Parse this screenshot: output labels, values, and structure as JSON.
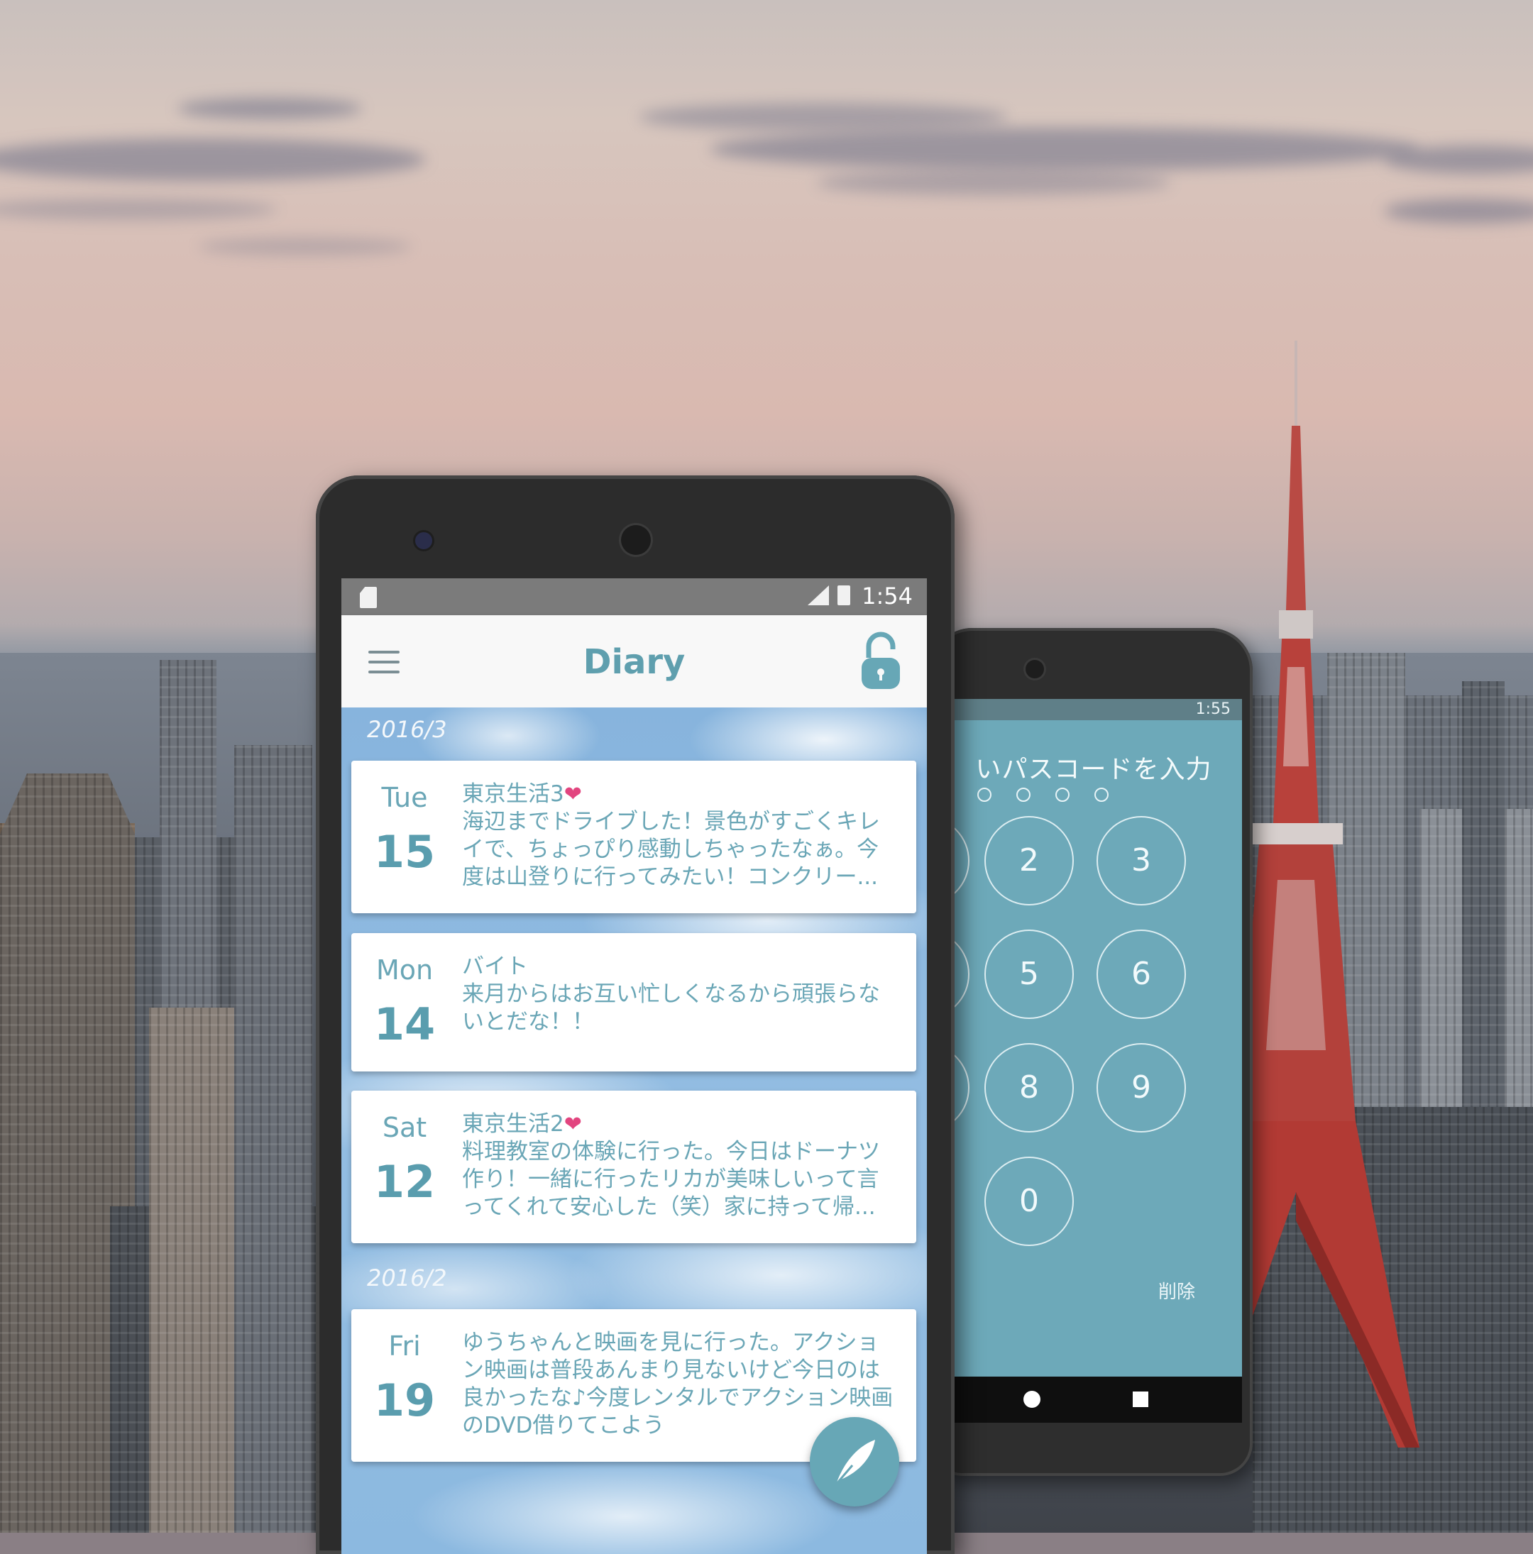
{
  "front_phone": {
    "status_bar": {
      "time": "1:54",
      "network": "4G"
    },
    "app_bar": {
      "title": "Diary",
      "menu_icon": "menu-icon",
      "lock_icon": "unlock-icon"
    },
    "months": [
      {
        "label": "2016/3"
      },
      {
        "label": "2016/2"
      }
    ],
    "entries": [
      {
        "dow": "Tue",
        "day": "15",
        "title": "東京生活3",
        "heart": "❤",
        "body": "海辺までドライブした！景色がすごくキレイで、ちょっぴり感動しちゃったなぁ。今度は山登りに行ってみたい！コンクリー..."
      },
      {
        "dow": "Mon",
        "day": "14",
        "title": "バイト",
        "heart": "",
        "body": "来月からはお互い忙しくなるから頑張らないとだな！！"
      },
      {
        "dow": "Sat",
        "day": "12",
        "title": "東京生活2",
        "heart": "❤",
        "body": "料理教室の体験に行った。今日はドーナツ作り！一緒に行ったリカが美味しいって言ってくれて安心した（笑）家に持って帰..."
      },
      {
        "dow": "Fri",
        "day": "19",
        "title": "",
        "heart": "",
        "body": "ゆうちゃんと映画を見に行った。アクション映画は普段あんまり見ないけど今日のは良かったな♪今度レンタルでアクション映画のDVD借りてこよう"
      }
    ],
    "fab_icon": "feather-pen-icon",
    "accent_color": "#67a7b6"
  },
  "back_phone": {
    "status_bar": {
      "time": "1:55",
      "network": "4G"
    },
    "passcode_title": "いパスコードを入力",
    "dots": 4,
    "keys": [
      "2",
      "3",
      "5",
      "6",
      "8",
      "9",
      "0"
    ],
    "delete_label": "削除",
    "screen_color": "#6da9b9"
  }
}
